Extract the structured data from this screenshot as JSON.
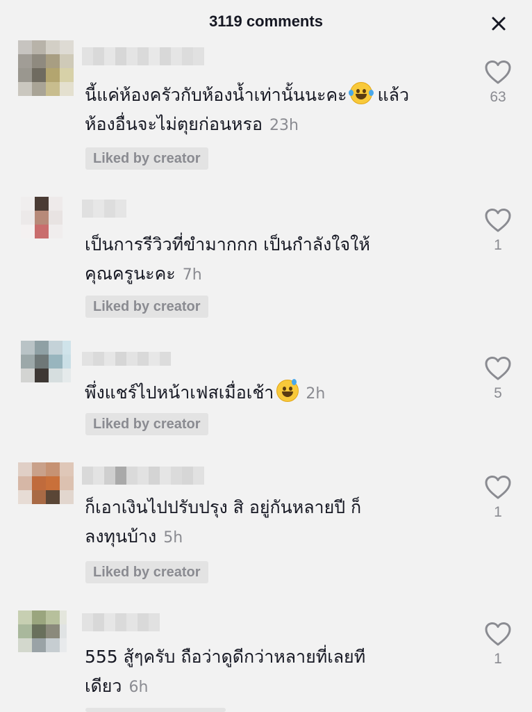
{
  "header": {
    "title": "3119 comments",
    "close_icon": "close-icon"
  },
  "colors": {
    "background": "#f2f2f2",
    "text": "#161823",
    "muted": "#8a8b91",
    "badge_bg": "#e3e3e3"
  },
  "comments": [
    {
      "lines": [
        "นี้แค่ห้องครัวกับห้องน้ำเท่านั้นนะคะ",
        "ห้องอื่นจะไม่ตุยก่อนหรอ"
      ],
      "line1_tail": "แล้ว",
      "emoji": "face-with-tears-of-joy-emoji",
      "time": "23h",
      "badge": "Liked by creator",
      "likes": "63",
      "like_icon": "heart-outline-icon"
    },
    {
      "lines": [
        "เป็นการรีวิวที่ขำมากกก เป็นกำลังใจให้",
        "คุณครูนะคะ"
      ],
      "time": "7h",
      "badge": "Liked by creator",
      "likes": "1",
      "like_icon": "heart-outline-icon"
    },
    {
      "lines": [
        "พึ่งแชร์ไปหน้าเฟสเมื่อเช้า"
      ],
      "emoji": "grinning-face-with-sweat-emoji",
      "time": "2h",
      "badge": "Liked by creator",
      "likes": "5",
      "like_icon": "heart-outline-icon"
    },
    {
      "lines": [
        "ก็เอาเงินไปปรับปรุง สิ อยู่กันหลายปี ก็",
        "ลงทุนบ้าง"
      ],
      "time": "5h",
      "badge": "Liked by creator",
      "likes": "1",
      "like_icon": "heart-outline-icon"
    },
    {
      "lines": [
        "555 สู้ๆครับ ถือว่าดูดีกว่าหลายที่เลยที",
        "เดียว"
      ],
      "time": "6h",
      "likes": "1",
      "like_icon": "heart-outline-icon"
    }
  ]
}
